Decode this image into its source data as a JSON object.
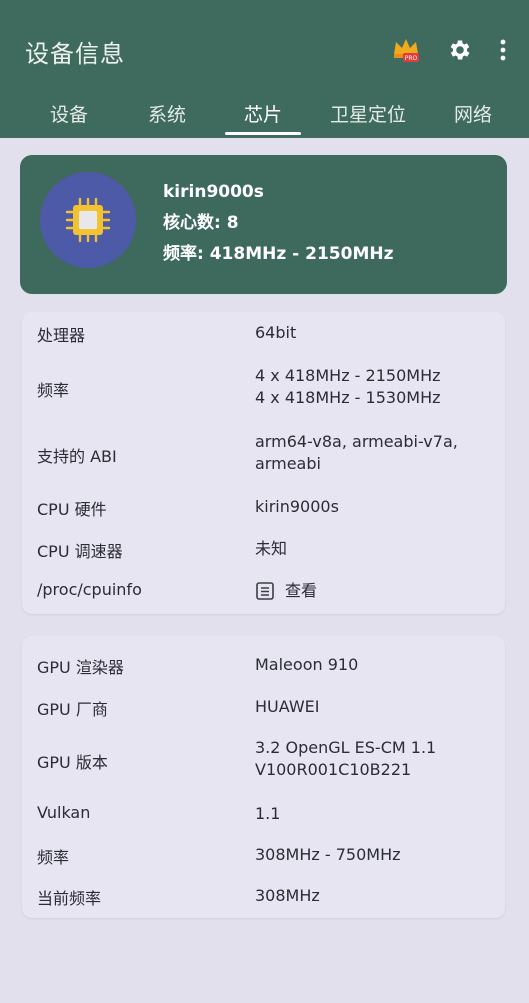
{
  "appbar": {
    "title": "设备信息"
  },
  "tabs": [
    "设备",
    "系统",
    "芯片",
    "卫星定位",
    "网络"
  ],
  "active_tab": 2,
  "hero": {
    "chip_name": "kirin9000s",
    "cores": "核心数: 8",
    "freq": "频率: 418MHz - 2150MHz"
  },
  "cpu": [
    {
      "label": "处理器",
      "value": [
        "64bit"
      ]
    },
    {
      "label": "频率",
      "value": [
        "4 x 418MHz - 2150MHz",
        "4 x 418MHz - 1530MHz"
      ]
    },
    {
      "label": "支持的 ABI",
      "value": [
        "arm64-v8a, armeabi-v7a,",
        "armeabi"
      ]
    },
    {
      "label": "CPU 硬件",
      "value": [
        "kirin9000s"
      ]
    },
    {
      "label": "CPU 调速器",
      "value": [
        "未知"
      ]
    },
    {
      "label": "/proc/cpuinfo",
      "value": [
        "查看"
      ]
    }
  ],
  "gpu": [
    {
      "label": "GPU 渲染器",
      "value": [
        "Maleoon 910"
      ]
    },
    {
      "label": "GPU 厂商",
      "value": [
        "HUAWEI"
      ]
    },
    {
      "label": "GPU 版本",
      "value": [
        "3.2 OpenGL ES-CM 1.1",
        "V100R001C10B221"
      ]
    },
    {
      "label": "Vulkan",
      "value": [
        "1.1"
      ]
    },
    {
      "label": "频率",
      "value": [
        "308MHz - 750MHz"
      ]
    },
    {
      "label": "当前频率",
      "value": [
        "308MHz"
      ]
    }
  ],
  "colors": {
    "appbar": "#3f6b5e",
    "hero": "#3e6a5d",
    "chip_circle": "#4c5aa8",
    "chip": "#f2c230"
  },
  "icons": [
    "pro-crown-icon",
    "gear-icon",
    "more-vert-icon",
    "chip-icon",
    "document-icon"
  ]
}
